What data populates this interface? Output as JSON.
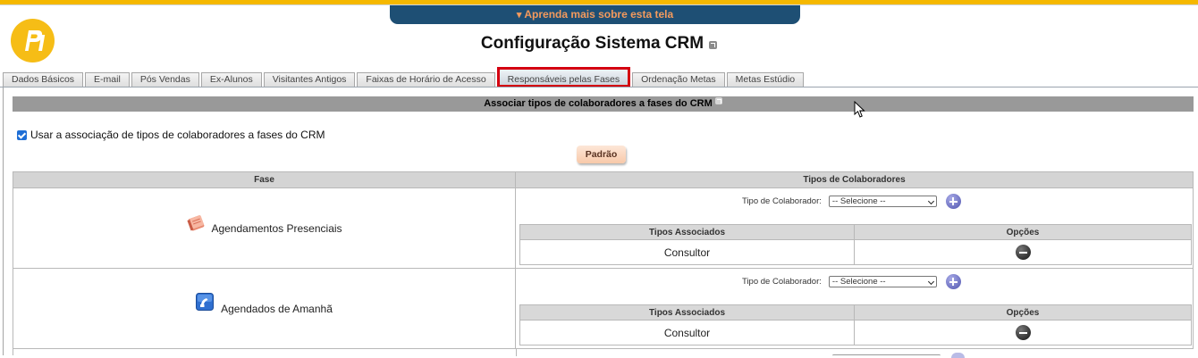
{
  "banner": {
    "learn_label": "Aprenda mais sobre esta tela"
  },
  "page": {
    "title": "Configuração Sistema CRM"
  },
  "tabs": [
    {
      "label": "Dados Básicos"
    },
    {
      "label": "E-mail"
    },
    {
      "label": "Pós Vendas"
    },
    {
      "label": "Ex-Alunos"
    },
    {
      "label": "Visitantes Antigos"
    },
    {
      "label": "Faixas de Horário de Acesso"
    },
    {
      "label": "Responsáveis pelas Fases",
      "active": true
    },
    {
      "label": "Ordenação Metas"
    },
    {
      "label": "Metas Estúdio"
    }
  ],
  "section": {
    "title": "Associar tipos de colaboradores a fases do CRM"
  },
  "option": {
    "checkbox_label": "Usar a associação de tipos de colaboradores a fases do CRM",
    "checked": true
  },
  "buttons": {
    "padrao": "Padrão"
  },
  "table": {
    "col_fase": "Fase",
    "col_tipos": "Tipos de Colaboradores",
    "tipo_label": "Tipo de Colaborador:",
    "select_value": "-- Selecione --",
    "sub_col_tipos": "Tipos Associados",
    "sub_col_opcoes": "Opções",
    "rows": [
      {
        "fase": "Agendamentos Presenciais",
        "icon": "notebook-icon",
        "tipos": [
          "Consultor"
        ]
      },
      {
        "fase": "Agendados de Amanhã",
        "icon": "phone-icon",
        "tipos": [
          "Consultor"
        ]
      }
    ]
  },
  "colors": {
    "accent_yellow": "#f5b800",
    "banner_bg": "#1e4f74",
    "banner_text": "#f39a5d",
    "active_tab_border": "#d40010"
  }
}
